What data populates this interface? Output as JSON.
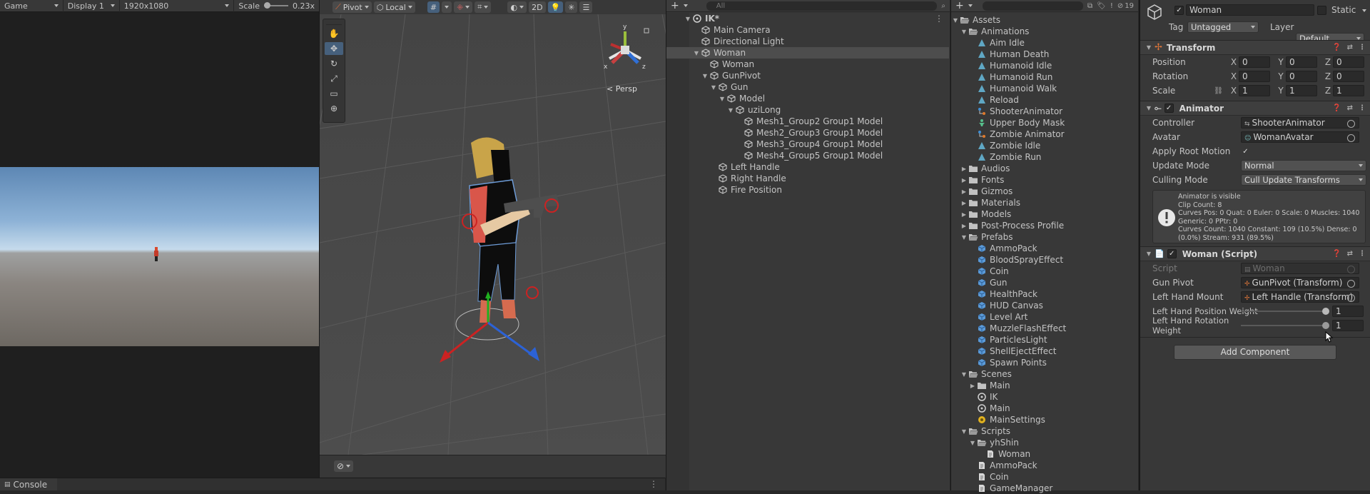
{
  "game": {
    "tab": "Game",
    "display": "Display 1",
    "resolution": "1920x1080",
    "scale_label": "Scale",
    "scale_value": "0.23x"
  },
  "scene": {
    "pivot": "Pivot",
    "local": "Local",
    "mode2d": "2D",
    "persp": "< Persp"
  },
  "console": {
    "tab": "Console"
  },
  "hierarchy": {
    "search_placeholder": "All",
    "rows": [
      {
        "label": "IK*",
        "depth": 0,
        "arrow": "down",
        "icon": "unity",
        "sel": false
      },
      {
        "label": "Main Camera",
        "depth": 1,
        "arrow": "",
        "icon": "cube",
        "sel": false
      },
      {
        "label": "Directional Light",
        "depth": 1,
        "arrow": "",
        "icon": "cube",
        "sel": false
      },
      {
        "label": "Woman",
        "depth": 1,
        "arrow": "down",
        "icon": "cube",
        "sel": true
      },
      {
        "label": "Woman",
        "depth": 2,
        "arrow": "",
        "icon": "cube",
        "sel": false
      },
      {
        "label": "GunPivot",
        "depth": 2,
        "arrow": "down",
        "icon": "cube",
        "sel": false
      },
      {
        "label": "Gun",
        "depth": 3,
        "arrow": "down",
        "icon": "cube",
        "sel": false
      },
      {
        "label": "Model",
        "depth": 4,
        "arrow": "down",
        "icon": "cube",
        "sel": false
      },
      {
        "label": "uziLong",
        "depth": 5,
        "arrow": "down",
        "icon": "cube",
        "sel": false
      },
      {
        "label": "Mesh1_Group2 Group1 Model",
        "depth": 6,
        "arrow": "",
        "icon": "cube",
        "sel": false
      },
      {
        "label": "Mesh2_Group3 Group1 Model",
        "depth": 6,
        "arrow": "",
        "icon": "cube",
        "sel": false
      },
      {
        "label": "Mesh3_Group4 Group1 Model",
        "depth": 6,
        "arrow": "",
        "icon": "cube",
        "sel": false
      },
      {
        "label": "Mesh4_Group5 Group1 Model",
        "depth": 6,
        "arrow": "",
        "icon": "cube",
        "sel": false
      },
      {
        "label": "Left Handle",
        "depth": 3,
        "arrow": "",
        "icon": "cube",
        "sel": false
      },
      {
        "label": "Right Handle",
        "depth": 3,
        "arrow": "",
        "icon": "cube",
        "sel": false
      },
      {
        "label": "Fire Position",
        "depth": 3,
        "arrow": "",
        "icon": "cube",
        "sel": false
      }
    ]
  },
  "project": {
    "search_count": "19",
    "rows": [
      {
        "label": "Assets",
        "depth": 0,
        "arrow": "down",
        "icon": "folder-open"
      },
      {
        "label": "Animations",
        "depth": 1,
        "arrow": "down",
        "icon": "folder-open"
      },
      {
        "label": "Aim Idle",
        "depth": 2,
        "arrow": "",
        "icon": "anim"
      },
      {
        "label": "Human Death",
        "depth": 2,
        "arrow": "",
        "icon": "anim"
      },
      {
        "label": "Humanoid Idle",
        "depth": 2,
        "arrow": "",
        "icon": "anim"
      },
      {
        "label": "Humanoid Run",
        "depth": 2,
        "arrow": "",
        "icon": "anim"
      },
      {
        "label": "Humanoid Walk",
        "depth": 2,
        "arrow": "",
        "icon": "anim"
      },
      {
        "label": "Reload",
        "depth": 2,
        "arrow": "",
        "icon": "anim"
      },
      {
        "label": "ShooterAnimator",
        "depth": 2,
        "arrow": "",
        "icon": "animator"
      },
      {
        "label": "Upper Body Mask",
        "depth": 2,
        "arrow": "",
        "icon": "mask"
      },
      {
        "label": "Zombie Animator",
        "depth": 2,
        "arrow": "",
        "icon": "animator"
      },
      {
        "label": "Zombie Idle",
        "depth": 2,
        "arrow": "",
        "icon": "anim"
      },
      {
        "label": "Zombie Run",
        "depth": 2,
        "arrow": "",
        "icon": "anim"
      },
      {
        "label": "Audios",
        "depth": 1,
        "arrow": "right",
        "icon": "folder"
      },
      {
        "label": "Fonts",
        "depth": 1,
        "arrow": "right",
        "icon": "folder"
      },
      {
        "label": "Gizmos",
        "depth": 1,
        "arrow": "right",
        "icon": "folder"
      },
      {
        "label": "Materials",
        "depth": 1,
        "arrow": "right",
        "icon": "folder"
      },
      {
        "label": "Models",
        "depth": 1,
        "arrow": "right",
        "icon": "folder"
      },
      {
        "label": "Post-Process Profile",
        "depth": 1,
        "arrow": "right",
        "icon": "folder"
      },
      {
        "label": "Prefabs",
        "depth": 1,
        "arrow": "down",
        "icon": "folder-open"
      },
      {
        "label": "AmmoPack",
        "depth": 2,
        "arrow": "",
        "icon": "prefab"
      },
      {
        "label": "BloodSprayEffect",
        "depth": 2,
        "arrow": "",
        "icon": "prefab"
      },
      {
        "label": "Coin",
        "depth": 2,
        "arrow": "",
        "icon": "prefab"
      },
      {
        "label": "Gun",
        "depth": 2,
        "arrow": "",
        "icon": "prefab"
      },
      {
        "label": "HealthPack",
        "depth": 2,
        "arrow": "",
        "icon": "prefab"
      },
      {
        "label": "HUD Canvas",
        "depth": 2,
        "arrow": "",
        "icon": "prefab"
      },
      {
        "label": "Level Art",
        "depth": 2,
        "arrow": "",
        "icon": "prefab"
      },
      {
        "label": "MuzzleFlashEffect",
        "depth": 2,
        "arrow": "",
        "icon": "prefab"
      },
      {
        "label": "ParticlesLight",
        "depth": 2,
        "arrow": "",
        "icon": "prefab"
      },
      {
        "label": "ShellEjectEffect",
        "depth": 2,
        "arrow": "",
        "icon": "prefab"
      },
      {
        "label": "Spawn Points",
        "depth": 2,
        "arrow": "",
        "icon": "prefab"
      },
      {
        "label": "Scenes",
        "depth": 1,
        "arrow": "down",
        "icon": "folder-open"
      },
      {
        "label": "Main",
        "depth": 2,
        "arrow": "right",
        "icon": "folder"
      },
      {
        "label": "IK",
        "depth": 2,
        "arrow": "",
        "icon": "unity"
      },
      {
        "label": "Main",
        "depth": 2,
        "arrow": "",
        "icon": "unity"
      },
      {
        "label": "MainSettings",
        "depth": 2,
        "arrow": "",
        "icon": "settings"
      },
      {
        "label": "Scripts",
        "depth": 1,
        "arrow": "down",
        "icon": "folder-open"
      },
      {
        "label": "yhShin",
        "depth": 2,
        "arrow": "down",
        "icon": "folder-open"
      },
      {
        "label": "Woman",
        "depth": 3,
        "arrow": "",
        "icon": "script"
      },
      {
        "label": "AmmoPack",
        "depth": 2,
        "arrow": "",
        "icon": "script"
      },
      {
        "label": "Coin",
        "depth": 2,
        "arrow": "",
        "icon": "script"
      },
      {
        "label": "GameManager",
        "depth": 2,
        "arrow": "",
        "icon": "script"
      }
    ]
  },
  "inspector": {
    "name": "Woman",
    "static_label": "Static",
    "tag_label": "Tag",
    "tag_value": "Untagged",
    "layer_label": "Layer",
    "layer_value": "Default",
    "transform": {
      "title": "Transform",
      "position_label": "Position",
      "rotation_label": "Rotation",
      "scale_label": "Scale",
      "position": {
        "x": "0",
        "y": "0",
        "z": "0"
      },
      "rotation": {
        "x": "0",
        "y": "0",
        "z": "0"
      },
      "scale": {
        "x": "1",
        "y": "1",
        "z": "1"
      }
    },
    "animator": {
      "title": "Animator",
      "controller_label": "Controller",
      "controller_value": "ShooterAnimator",
      "avatar_label": "Avatar",
      "avatar_value": "WomanAvatar",
      "root_motion_label": "Apply Root Motion",
      "update_label": "Update Mode",
      "update_value": "Normal",
      "culling_label": "Culling Mode",
      "culling_value": "Cull Update Transforms",
      "info_lines": [
        "Animator is visible",
        "Clip Count: 8",
        "Curves Pos: 0 Quat: 0 Euler: 0 Scale: 0 Muscles: 1040",
        "Generic: 0 PPtr: 0",
        "Curves Count: 1040 Constant: 109 (10.5%) Dense: 0",
        "(0.0%) Stream: 931 (89.5%)"
      ]
    },
    "script": {
      "title": "Woman (Script)",
      "script_label": "Script",
      "script_value": "Woman",
      "gunpivot_label": "Gun Pivot",
      "gunpivot_value": "GunPivot (Transform)",
      "lefthand_label": "Left Hand Mount",
      "lefthand_value": "Left Handle (Transform)",
      "lhpw_label": "Left Hand Position Weight",
      "lhpw_value": "1",
      "lhrw_label": "Left Hand Rotation Weight",
      "lhrw_value": "1"
    },
    "add_component": "Add Component"
  },
  "colors": {
    "accent": "#46607c",
    "selection": "#4d4d4d",
    "panel": "#383838",
    "warning": "#e8e8e8"
  }
}
